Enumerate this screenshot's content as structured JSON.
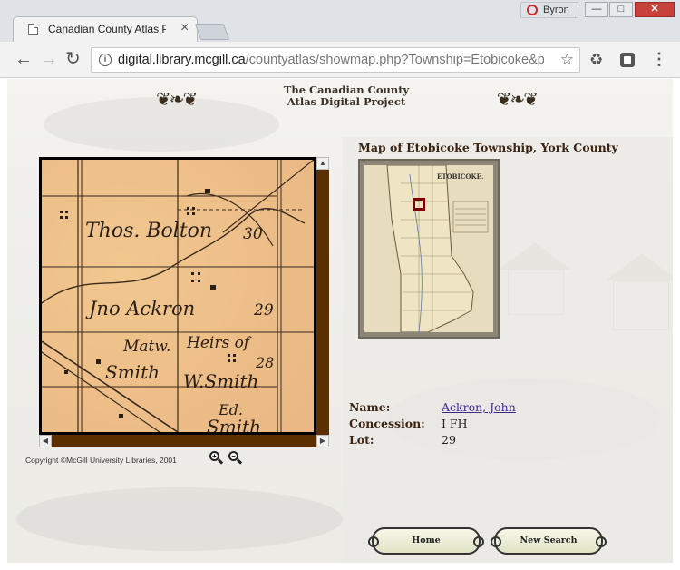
{
  "browser": {
    "tab_title": "Canadian County Atlas P",
    "tab_close": "×",
    "profile_name": "Byron",
    "window_buttons": {
      "minimize": "—",
      "maximize": "□",
      "close": "✕"
    },
    "url_host": "digital.library.mcgill.ca",
    "url_path": "/countyatlas/showmap.php?Township=Etobicoke&plotX",
    "nav": {
      "back": "←",
      "forward": "→",
      "reload": "↻"
    },
    "star": "☆",
    "menu": "⋮",
    "ext_icon": "♻"
  },
  "header": {
    "title_line1": "The Canadian County",
    "title_line2": "Atlas Digital Project",
    "ornament_left": "❦❧❦",
    "ornament_right": "❦❧❦"
  },
  "map_viewer": {
    "labels": {
      "bolton": "Thos. Bolton",
      "lot30": "30",
      "ackron": "Jno Ackron",
      "lot29": "29",
      "matt_smith_1": "Matw.",
      "matt_smith_2": "Smith",
      "heirs": "Heirs of",
      "wsmith": "W.Smith",
      "lot28": "28",
      "edsmith_1": "Ed.",
      "edsmith_2": "Smith"
    },
    "copyright": "Copyright ©McGill University Libraries, 2001",
    "scroll_arrows": {
      "up": "▲",
      "left": "◀",
      "right": "▶"
    },
    "zoom_in": "+",
    "zoom_out": "−"
  },
  "details": {
    "map_title": "Map of Etobicoke Township, York County",
    "thumb_label": "ETOBICOKE.",
    "name_label": "Name:",
    "name_value": "Ackron, John",
    "concession_label": "Concession:",
    "concession_value": "I FH",
    "lot_label": "Lot:",
    "lot_value": "29"
  },
  "buttons": {
    "home": "Home",
    "new_search": "New Search"
  }
}
